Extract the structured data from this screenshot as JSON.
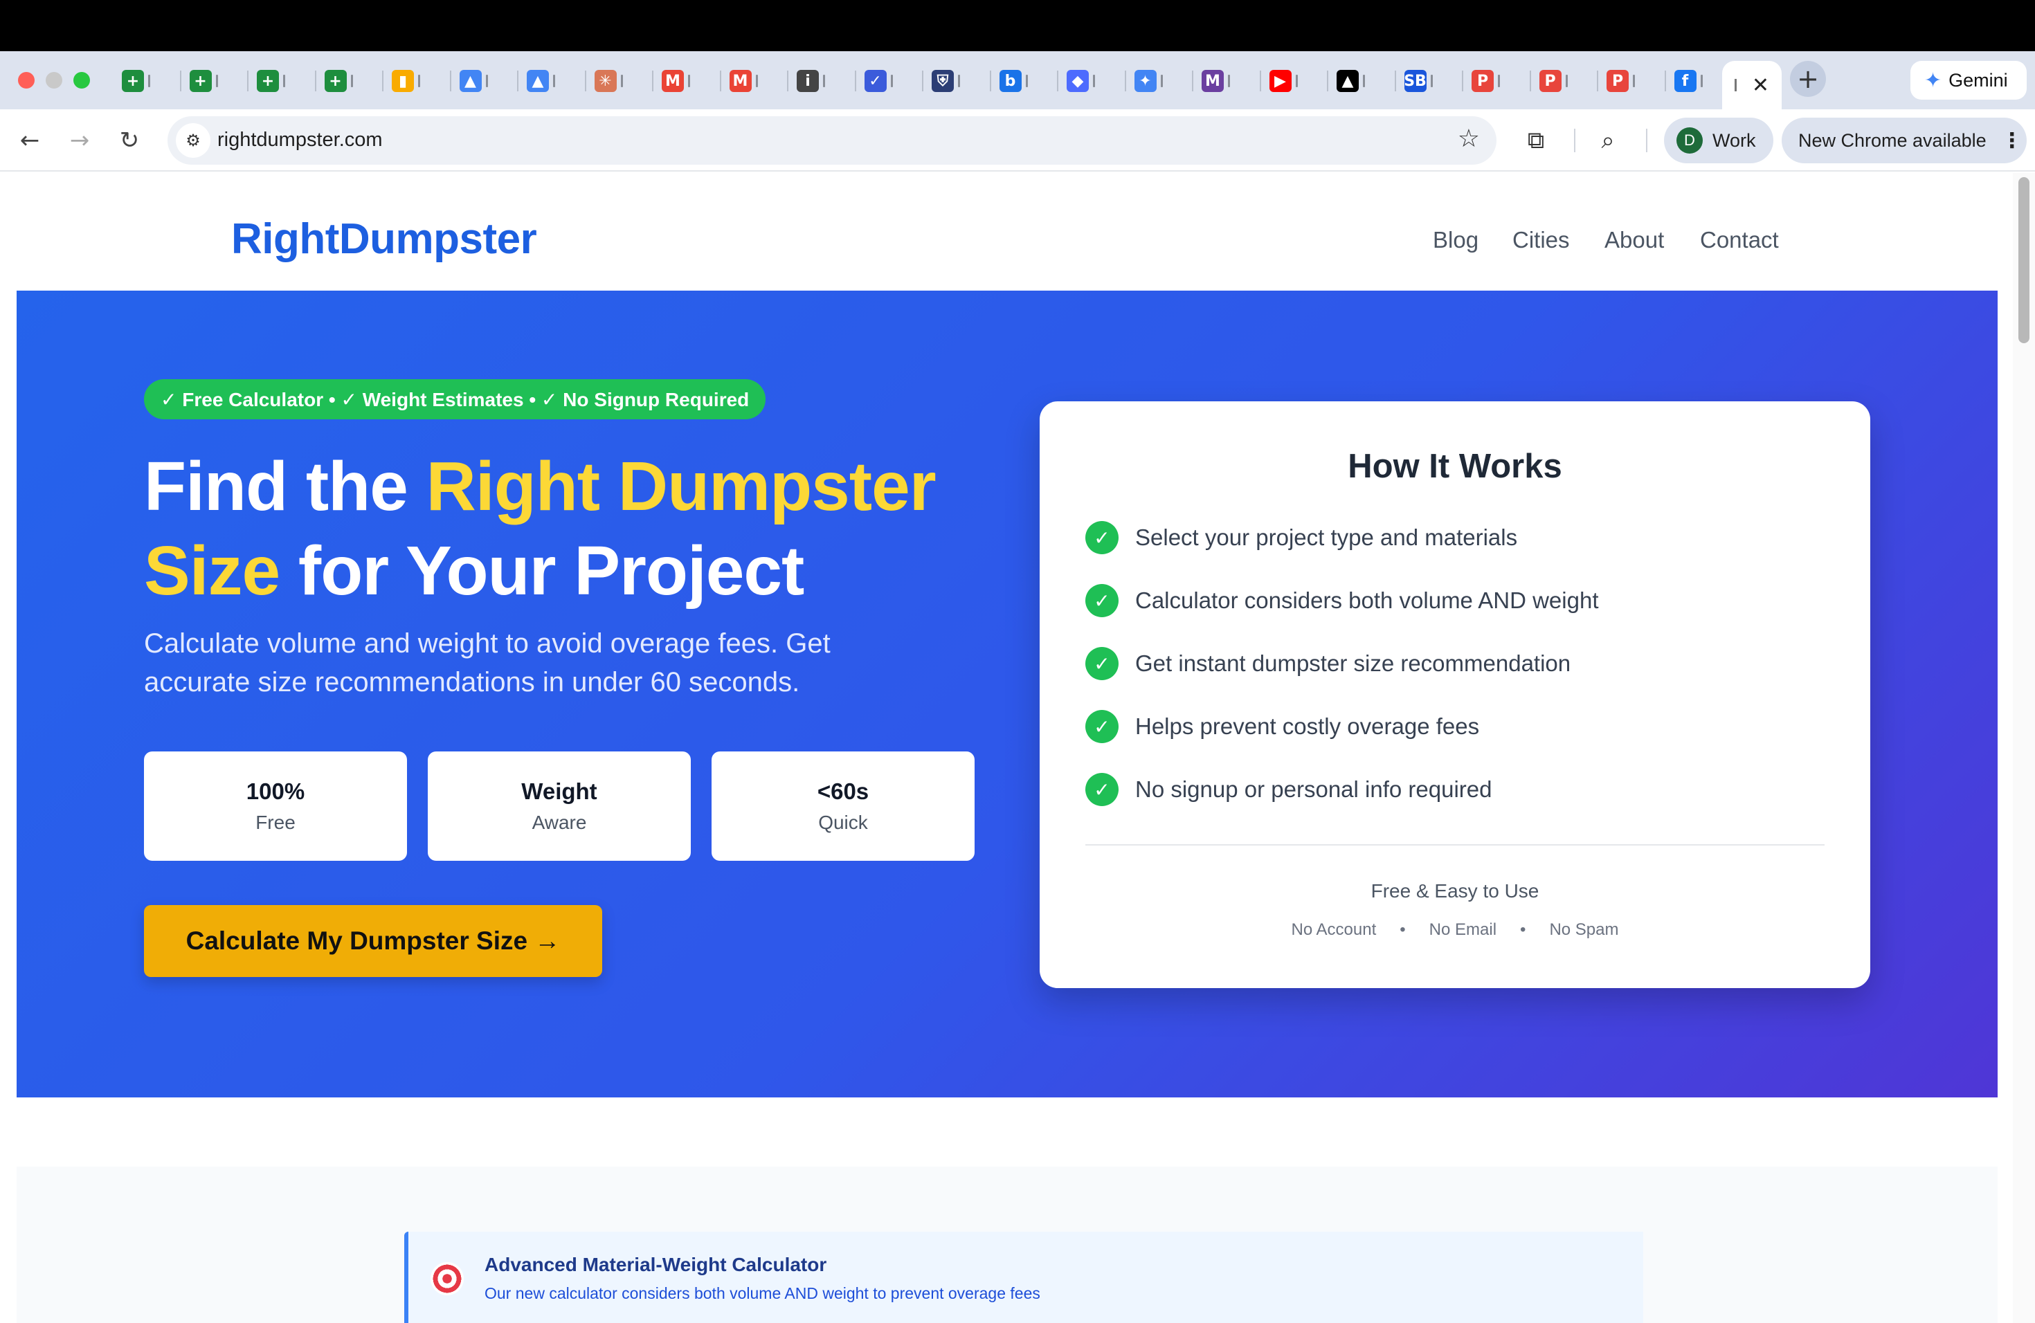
{
  "browser": {
    "active_tab_close": "✕",
    "new_tab_symbol": "+",
    "gemini_label": "Gemini",
    "url": "rightdumpster.com",
    "profile_initial": "D",
    "profile_label": "Work",
    "update_label": "New Chrome available",
    "tab_favicons": [
      {
        "icon": "sheets-icon",
        "color": "#1e8e3e",
        "glyph": "+"
      },
      {
        "icon": "sheets-icon",
        "color": "#1e8e3e",
        "glyph": "+"
      },
      {
        "icon": "sheets-icon",
        "color": "#1e8e3e",
        "glyph": "+"
      },
      {
        "icon": "sheets-icon",
        "color": "#1e8e3e",
        "glyph": "+"
      },
      {
        "icon": "analytics-icon",
        "color": "#f9ab00",
        "glyph": "▮"
      },
      {
        "icon": "ads-icon",
        "color": "#4285f4",
        "glyph": "▲"
      },
      {
        "icon": "ads-icon",
        "color": "#4285f4",
        "glyph": "▲"
      },
      {
        "icon": "claude-icon",
        "color": "#d97757",
        "glyph": "✳"
      },
      {
        "icon": "gmail-icon",
        "color": "#ea4335",
        "glyph": "M"
      },
      {
        "icon": "gmail-icon",
        "color": "#ea4335",
        "glyph": "M"
      },
      {
        "icon": "info-icon",
        "color": "#444444",
        "glyph": "i"
      },
      {
        "icon": "check-icon",
        "color": "#3b5bdb",
        "glyph": "✓"
      },
      {
        "icon": "shield-icon",
        "color": "#2c3e75",
        "glyph": "⛨"
      },
      {
        "icon": "bing-icon",
        "color": "#1a73e8",
        "glyph": "b"
      },
      {
        "icon": "deepseek-icon",
        "color": "#4d6bfe",
        "glyph": "◆"
      },
      {
        "icon": "gemini-icon",
        "color": "#4285f4",
        "glyph": "✦"
      },
      {
        "icon": "m-icon",
        "color": "#6b3fa0",
        "glyph": "M"
      },
      {
        "icon": "youtube-icon",
        "color": "#ff0000",
        "glyph": "▶"
      },
      {
        "icon": "a-icon",
        "color": "#000000",
        "glyph": "▲"
      },
      {
        "icon": "sb-icon",
        "color": "#1a56db",
        "glyph": "SB"
      },
      {
        "icon": "p-icon",
        "color": "#e8453c",
        "glyph": "P"
      },
      {
        "icon": "p-icon",
        "color": "#e8453c",
        "glyph": "P"
      },
      {
        "icon": "p-icon",
        "color": "#e8453c",
        "glyph": "P"
      },
      {
        "icon": "facebook-icon",
        "color": "#1877f2",
        "glyph": "f"
      }
    ]
  },
  "site": {
    "logo": "RightDumpster",
    "nav": [
      "Blog",
      "Cities",
      "About",
      "Contact"
    ]
  },
  "hero": {
    "badge": "✓ Free Calculator • ✓ Weight Estimates • ✓ No Signup Required",
    "title_part1": "Find the ",
    "title_highlight": "Right Dumpster Size",
    "title_part2": " for Your Project",
    "subtitle": "Calculate volume and weight to avoid overage fees. Get accurate size recommendations in under 60 seconds.",
    "stats": [
      {
        "value": "100%",
        "label": "Free"
      },
      {
        "value": "Weight",
        "label": "Aware"
      },
      {
        "value": "<60s",
        "label": "Quick"
      }
    ],
    "cta": "Calculate My Dumpster Size →"
  },
  "how_it_works": {
    "title": "How It Works",
    "items": [
      "Select your project type and materials",
      "Calculator considers both volume AND weight",
      "Get instant dumpster size recommendation",
      "Helps prevent costly overage fees",
      "No signup or personal info required"
    ],
    "footer": "Free & Easy to Use",
    "subs": [
      "No Account",
      "No Email",
      "No Spam"
    ],
    "separator": "•"
  },
  "notice": {
    "title": "Advanced Material-Weight Calculator",
    "text": "Our new calculator considers both volume AND weight to prevent overage fees"
  },
  "colors": {
    "brand_blue": "#1d5fe0",
    "highlight_yellow": "#fcd836",
    "cta_orange": "#f0ad06",
    "success_green": "#1fbf55"
  }
}
